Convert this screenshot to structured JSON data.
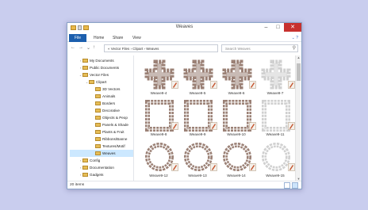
{
  "window": {
    "title": "Weaves"
  },
  "ribbon": {
    "tabs": [
      "File",
      "Home",
      "Share",
      "View"
    ]
  },
  "address": {
    "path": "« Vector Files  ›  Clipart  ›  Weaves",
    "search_placeholder": "Search Weaves"
  },
  "nav_tree": [
    {
      "label": "My Documents",
      "arrow": "›"
    },
    {
      "label": "Public Documents",
      "arrow": "›"
    },
    {
      "label": "Vector Files",
      "arrow": "⌄"
    },
    {
      "label": "Clipart",
      "arrow": "⌄"
    },
    {
      "label": "3D Vectors",
      "arrow": ""
    },
    {
      "label": "Animals",
      "arrow": ""
    },
    {
      "label": "Borders",
      "arrow": ""
    },
    {
      "label": "Decorative",
      "arrow": ""
    },
    {
      "label": "Objects & Peop",
      "arrow": ""
    },
    {
      "label": "Panels & Shade",
      "arrow": ""
    },
    {
      "label": "Plants & Fruit",
      "arrow": ""
    },
    {
      "label": "Ribbons/Banne",
      "arrow": ""
    },
    {
      "label": "Textures/Motif",
      "arrow": ""
    },
    {
      "label": "Weaves",
      "arrow": "",
      "selected": true
    },
    {
      "label": "Config",
      "arrow": "›"
    },
    {
      "label": "Documentation",
      "arrow": "›"
    },
    {
      "label": "Gadgets",
      "arrow": "›"
    }
  ],
  "files": [
    {
      "label": "Weave9-4",
      "shape": "cross",
      "color": "#9b8176"
    },
    {
      "label": "Weave9-5",
      "shape": "cross",
      "color": "#9b8176"
    },
    {
      "label": "Weave9-6",
      "shape": "cross",
      "color": "#9b8176"
    },
    {
      "label": "Weave9-7",
      "shape": "cross",
      "color": "#d0d0d0"
    },
    {
      "label": "Weave9-8",
      "shape": "square",
      "color": "#9b8176"
    },
    {
      "label": "Weave9-9",
      "shape": "square",
      "color": "#9b8176"
    },
    {
      "label": "Weave9-10",
      "shape": "square",
      "color": "#9b8176"
    },
    {
      "label": "Weave9-11",
      "shape": "square",
      "color": "#d0d0d0"
    },
    {
      "label": "Weave9-12",
      "shape": "ring",
      "color": "#9b8176"
    },
    {
      "label": "Weave9-13",
      "shape": "ring",
      "color": "#9b8176"
    },
    {
      "label": "Weave9-14",
      "shape": "ring",
      "color": "#9b8176"
    },
    {
      "label": "Weave9-15",
      "shape": "ring",
      "color": "#d0d0d0"
    }
  ],
  "status": {
    "item_count": "20 items"
  },
  "colors": {
    "desktop": "#c9cdee",
    "selection": "#cce8ff",
    "close": "#c7312e",
    "file_tab": "#1c5fad"
  }
}
